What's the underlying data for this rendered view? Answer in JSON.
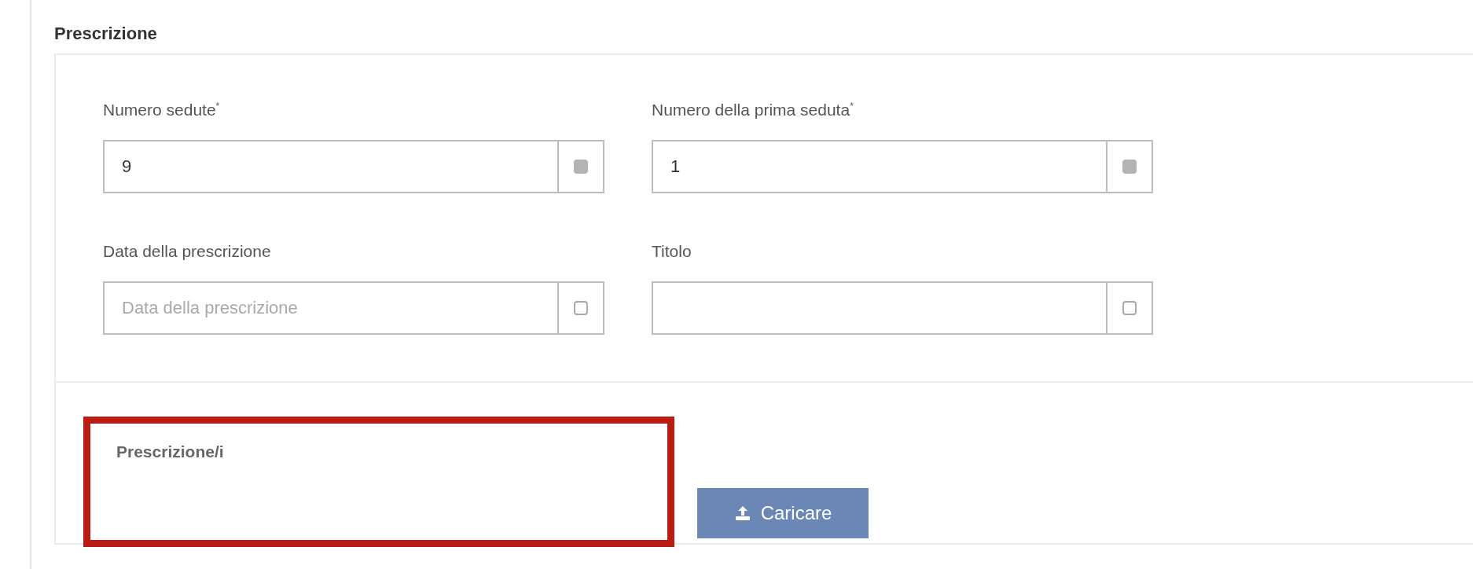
{
  "section_title": "Prescrizione",
  "fields": [
    {
      "label": "Numero sedute$^{*}$",
      "value": "9",
      "checked": true
    },
    {
      "label": "Numero della prima seduta$^{*}$",
      "value": "1",
      "checked": true
    },
    {
      "label": "Data della prescrizione",
      "placeholder": "Data della prescrizione",
      "checked": false
    },
    {
      "label": "Titolo",
      "checked": false
    }
  ],
  "upload": {
    "label": "Prescrizione/i",
    "button": "Caricare"
  }
}
